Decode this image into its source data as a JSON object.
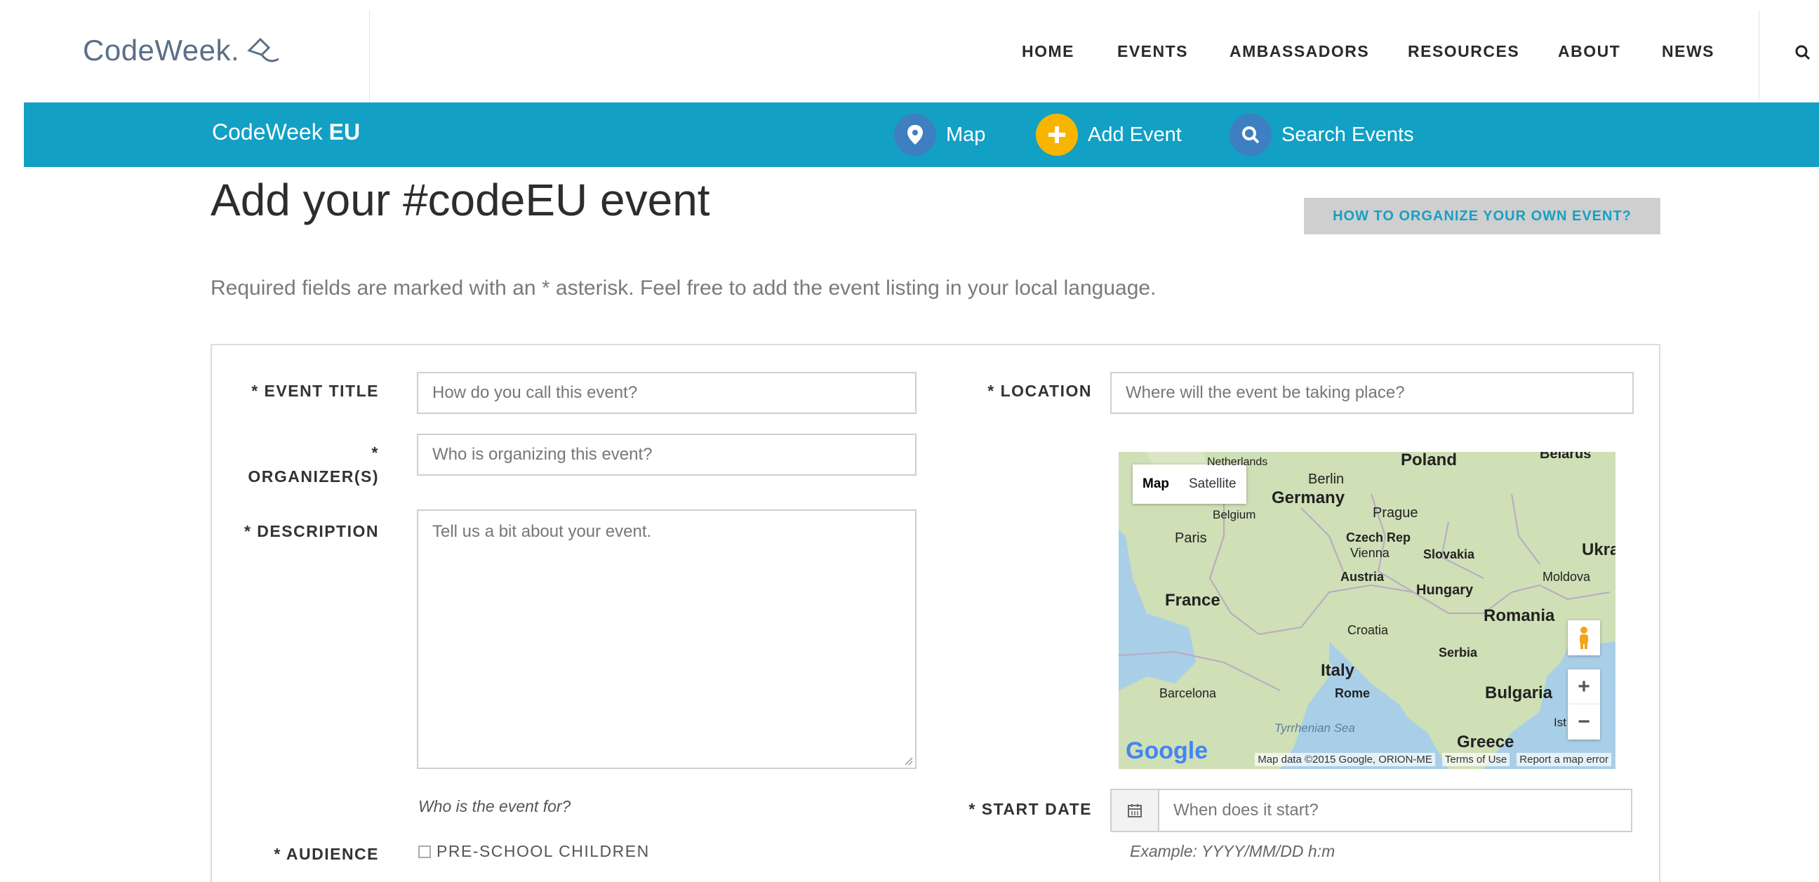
{
  "header": {
    "logo_text": "CodeWeek.",
    "menu": [
      "HOME",
      "EVENTS",
      "AMBASSADORS",
      "RESOURCES",
      "ABOUT",
      "NEWS"
    ]
  },
  "subbar": {
    "brand_light": "CodeWeek",
    "brand_bold": "EU",
    "items": [
      {
        "label": "Map",
        "icon": "map-pin-icon",
        "color": "#3d7fc1"
      },
      {
        "label": "Add Event",
        "icon": "plus-icon",
        "color": "#f7b500"
      },
      {
        "label": "Search Events",
        "icon": "search-icon",
        "color": "#3d7fc1"
      }
    ]
  },
  "main": {
    "title": "Add your #codeEU event",
    "howto_button": "HOW TO ORGANIZE YOUR OWN EVENT?",
    "intro": "Required fields are marked with an * asterisk. Feel free to add the event listing in your local language."
  },
  "form": {
    "event_title": {
      "label": "* EVENT TITLE",
      "placeholder": "How do you call this event?"
    },
    "organizer": {
      "label_line1": "*",
      "label_line2": "ORGANIZER(S)",
      "placeholder": "Who is organizing this event?"
    },
    "description": {
      "label": "* DESCRIPTION",
      "placeholder": "Tell us a bit about your event."
    },
    "audience": {
      "label": "* AUDIENCE",
      "hint": "Who is the event for?",
      "options": [
        "PRE-SCHOOL CHILDREN"
      ]
    },
    "location": {
      "label": "* LOCATION",
      "placeholder": "Where will the event be taking place?"
    },
    "start_date": {
      "label": "* START DATE",
      "placeholder": "When does it start?",
      "example": "Example: YYYY/MM/DD h:m"
    }
  },
  "map": {
    "type_buttons": [
      "Map",
      "Satellite"
    ],
    "zoom_in": "+",
    "zoom_out": "−",
    "labels": {
      "netherlands": "Netherlands",
      "poland": "Poland",
      "belarus": "Belarus",
      "berlin": "Berlin",
      "germany": "Germany",
      "belgium": "Belgium",
      "prague": "Prague",
      "paris": "Paris",
      "czech": "Czech Rep",
      "vienna": "Vienna",
      "slovakia": "Slovakia",
      "ukraine": "Ukra",
      "austria": "Austria",
      "moldova": "Moldova",
      "france": "France",
      "hungary": "Hungary",
      "romania": "Romania",
      "croatia": "Croatia",
      "serbia": "Serbia",
      "italy": "Italy",
      "barcelona": "Barcelona",
      "rome": "Rome",
      "bulgaria": "Bulgaria",
      "tyrrhenian": "Tyrrhenian Sea",
      "greece": "Greece",
      "ist": "Ist"
    },
    "google": "Google",
    "footer": [
      "Map data ©2015 Google, ORION-ME",
      "Terms of Use",
      "Report a map error"
    ]
  }
}
